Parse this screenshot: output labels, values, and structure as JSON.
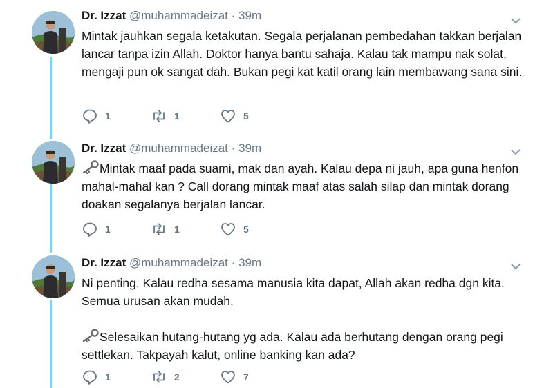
{
  "tweets": [
    {
      "name": "Dr. Izzat",
      "handle": "@muhammadeizat",
      "separator": "·",
      "time": "39m",
      "paragraphs": [
        {
          "icon": "",
          "text": "Mintak jauhkan segala ketakutan. Segala perjalanan pembedahan takkan berjalan lancar tanpa izin Allah. Doktor hanya bantu sahaja. Kalau tak mampu nak solat, mengaji pun ok sangat dah. Bukan pegi kat katil orang lain membawang sana sini."
        }
      ],
      "replies": "1",
      "retweets": "1",
      "likes": "5"
    },
    {
      "name": "Dr. Izzat",
      "handle": "@muhammadeizat",
      "separator": "·",
      "time": "39m",
      "paragraphs": [
        {
          "icon": "key-icon",
          "text": "Mintak maaf pada suami, mak dan ayah. Kalau depa ni jauh, apa guna henfon mahal-mahal kan ? Call dorang mintak maaf atas salah silap dan mintak dorang doakan segalanya berjalan lancar."
        }
      ],
      "replies": "1",
      "retweets": "1",
      "likes": "5"
    },
    {
      "name": "Dr. Izzat",
      "handle": "@muhammadeizat",
      "separator": "·",
      "time": "39m",
      "paragraphs": [
        {
          "icon": "",
          "text": "Ni penting. Kalau redha sesama manusia kita dapat, Allah akan redha dgn kita. Semua urusan akan mudah."
        },
        {
          "icon": "key-icon",
          "text": "Selesaikan hutang-hutang yg ada. Kalau ada berhutang dengan orang pegi settlekan. Takpayah kalut, online banking kan ada?"
        }
      ],
      "replies": "1",
      "retweets": "2",
      "likes": "7"
    }
  ]
}
